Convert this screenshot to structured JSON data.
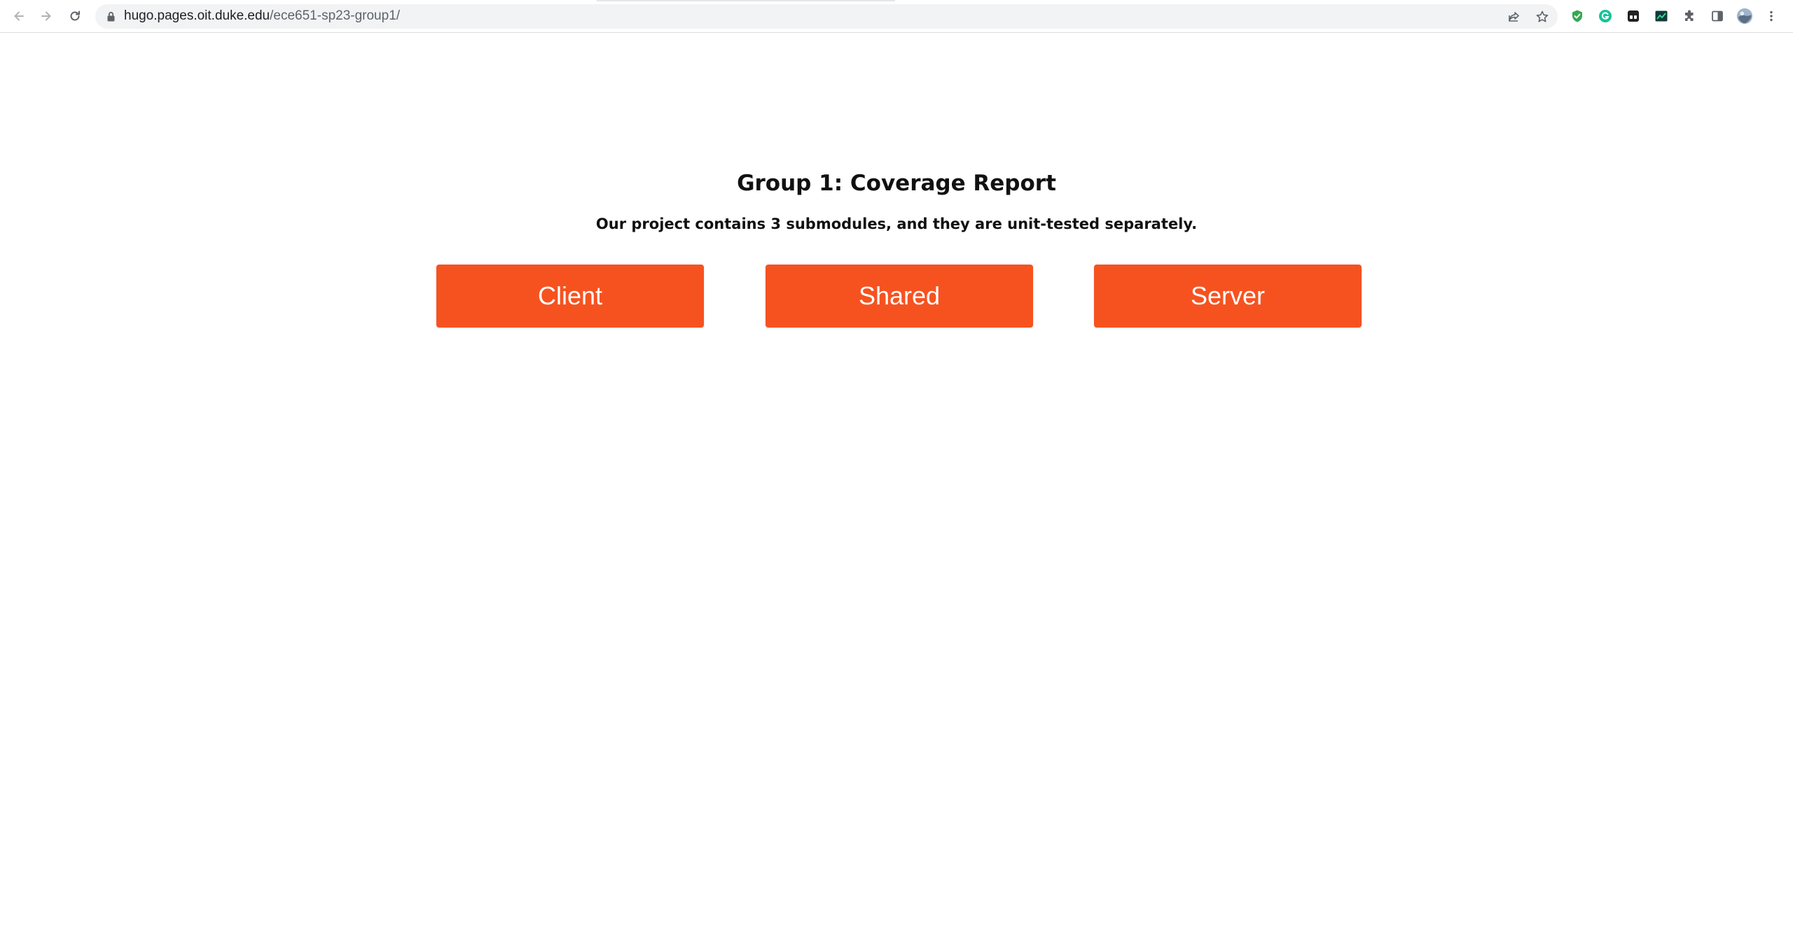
{
  "browser": {
    "url_host": "hugo.pages.oit.duke.edu",
    "url_path": "/ece651-sp23-group1/",
    "icons": {
      "back": "arrow-left-icon",
      "forward": "arrow-right-icon",
      "reload": "reload-icon",
      "lock": "lock-icon",
      "share": "share-icon",
      "bookmark": "star-icon",
      "extensions": [
        "shield-check-extension-icon",
        "grammarly-extension-icon",
        "dark-extension-icon",
        "chart-extension-icon",
        "puzzle-icon"
      ],
      "side_panel": "side-panel-icon",
      "profile": "avatar",
      "menu": "kebab-menu-icon"
    }
  },
  "page": {
    "title": "Group 1: Coverage Report",
    "subtitle": "Our project contains 3 submodules, and they are unit-tested separately.",
    "buttons": [
      {
        "label": "Client"
      },
      {
        "label": "Shared"
      },
      {
        "label": "Server"
      }
    ],
    "accent_color": "#f65220"
  }
}
